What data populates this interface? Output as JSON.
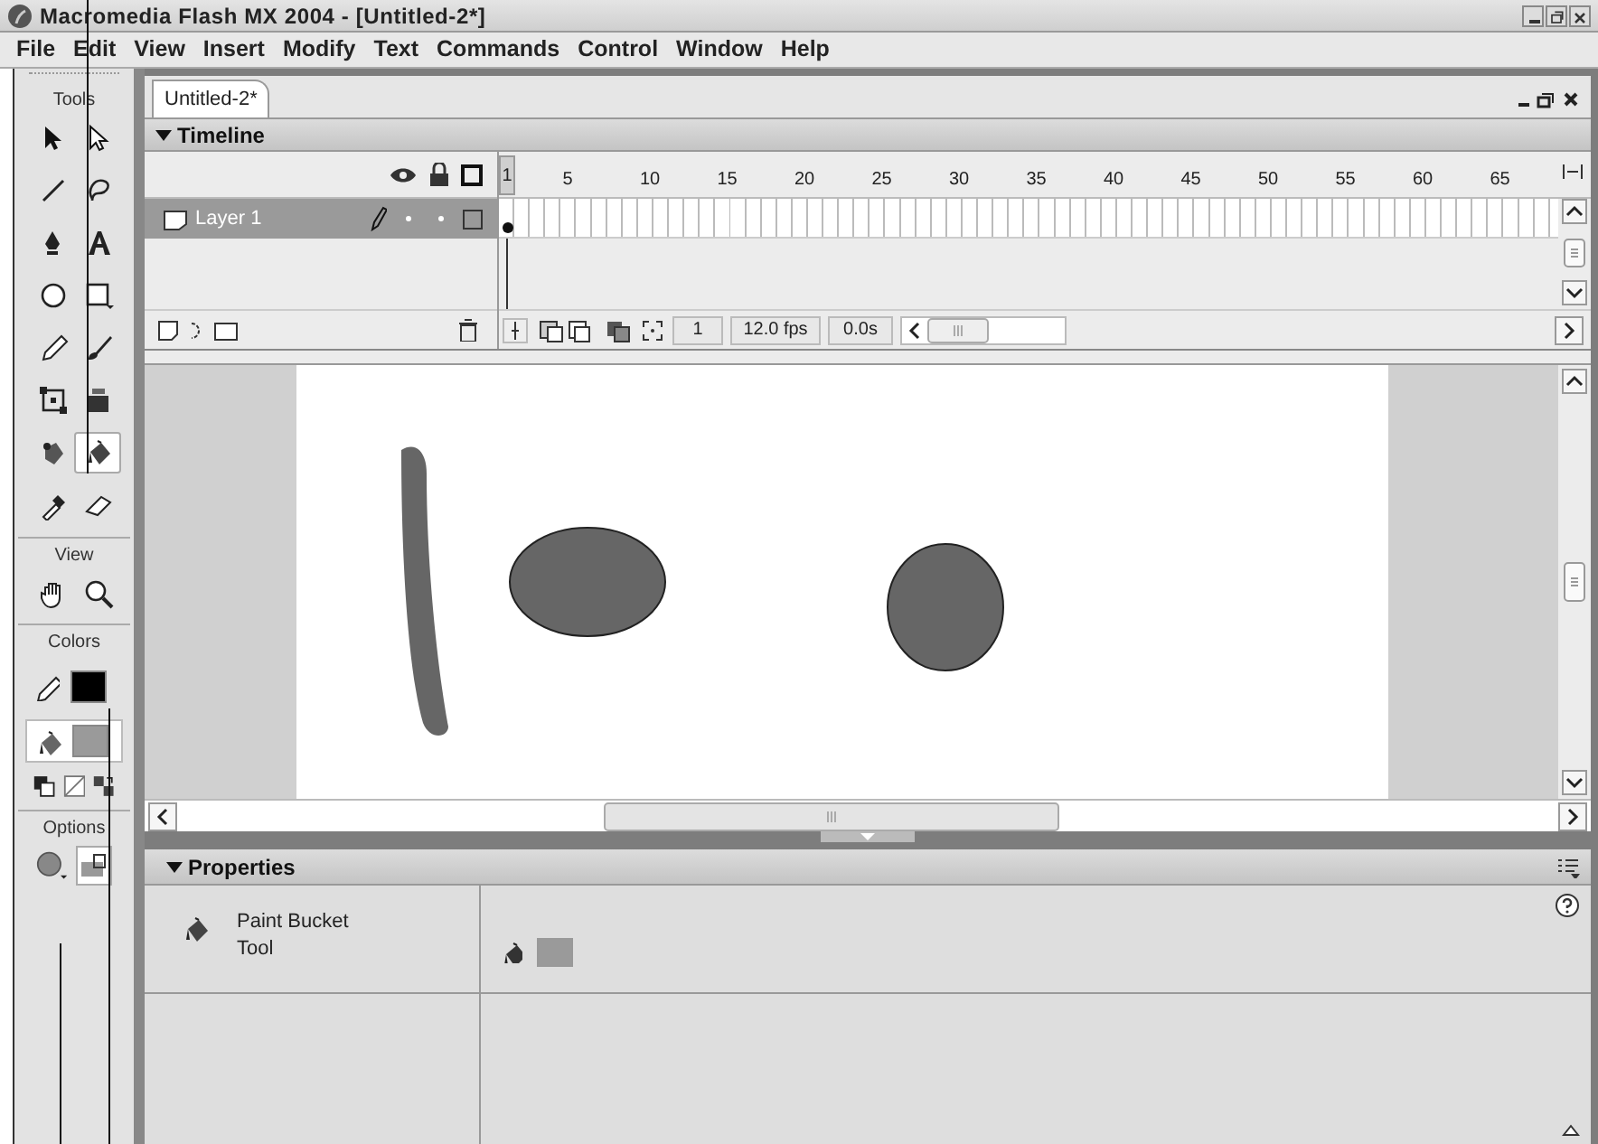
{
  "window": {
    "title": "Macromedia Flash MX 2004 - [Untitled-2*]"
  },
  "menu": [
    "File",
    "Edit",
    "View",
    "Insert",
    "Modify",
    "Text",
    "Commands",
    "Control",
    "Window",
    "Help"
  ],
  "tools": {
    "title": "Tools",
    "items": [
      {
        "kind": "arrow",
        "selected": false
      },
      {
        "kind": "subselect",
        "selected": false
      },
      {
        "kind": "line",
        "selected": false
      },
      {
        "kind": "lasso",
        "selected": false
      },
      {
        "kind": "pen",
        "selected": false
      },
      {
        "kind": "text",
        "selected": false
      },
      {
        "kind": "oval",
        "selected": false
      },
      {
        "kind": "rect",
        "selected": false
      },
      {
        "kind": "pencil",
        "selected": false
      },
      {
        "kind": "brush",
        "selected": false
      },
      {
        "kind": "transform",
        "selected": false
      },
      {
        "kind": "gradient",
        "selected": false
      },
      {
        "kind": "inkbottle",
        "selected": false
      },
      {
        "kind": "bucket",
        "selected": true
      },
      {
        "kind": "dropper",
        "selected": false
      },
      {
        "kind": "eraser",
        "selected": false
      }
    ]
  },
  "view": {
    "title": "View",
    "items": [
      {
        "kind": "hand"
      },
      {
        "kind": "zoom"
      }
    ]
  },
  "colors": {
    "title": "Colors",
    "swatches": [
      {
        "kind": "stroke",
        "color": "#000000"
      },
      {
        "kind": "fill",
        "color": "#9a9a9a"
      }
    ]
  },
  "options": {
    "title": "Options"
  },
  "document": {
    "tab": "Untitled-2*"
  },
  "timeline": {
    "title": "Timeline",
    "frames": [
      "1",
      "5",
      "10",
      "15",
      "20",
      "25",
      "30",
      "35",
      "40",
      "45",
      "50",
      "55",
      "60",
      "65"
    ],
    "layers": [
      {
        "name": "Layer 1",
        "selected": true
      }
    ],
    "current_frame": "1",
    "fps": "12.0 fps",
    "time": "0.0s"
  },
  "properties": {
    "title": "Properties",
    "tool_name": "Paint Bucket\nTool"
  }
}
